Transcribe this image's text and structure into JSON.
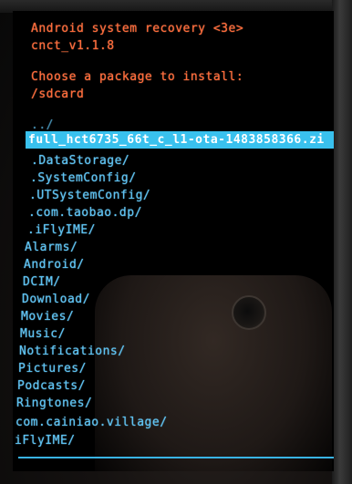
{
  "recovery": {
    "header": {
      "title": "Android system recovery <3e>",
      "version": "cnct_v1.1.8",
      "prompt": "Choose a package to install:",
      "path": "/sdcard"
    },
    "parent_entry": "../",
    "selected_item": "full_hct6735_66t_c_l1-ota-1483858366.zi",
    "items": [
      ".DataStorage/",
      ".SystemConfig/",
      ".UTSystemConfig/",
      ".com.taobao.dp/",
      ".iFlyIME/",
      "Alarms/",
      "Android/",
      "DCIM/",
      "Download/",
      "Movies/",
      "Music/",
      "Notifications/",
      "Pictures/",
      "Podcasts/",
      "Ringtones/",
      "com.cainiao.village/",
      "iFlyIME/"
    ]
  }
}
